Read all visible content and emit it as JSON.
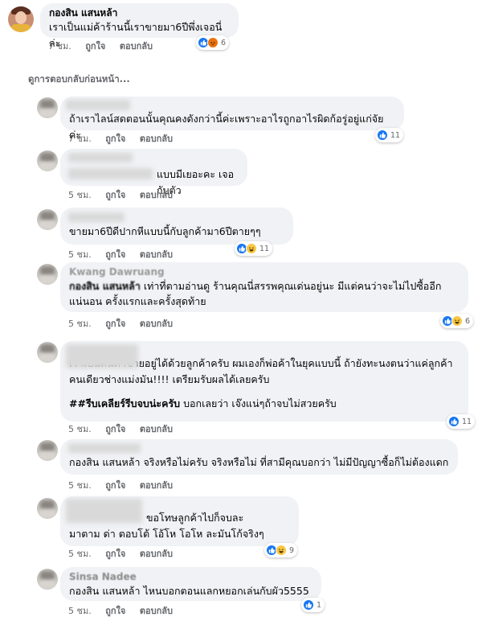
{
  "main_comment": {
    "author": "กองสิน แสนหล้า",
    "text": "เราเป็นแม่ค้าร้านนี้เราขายมา6ปีพึ่งเจอนี่ล่ะ",
    "time": "7 ชม.",
    "like_label": "ถูกใจ",
    "reply_label": "ตอบกลับ",
    "reaction_count": "6",
    "reaction_icons": [
      "like-icon",
      "angry-icon"
    ]
  },
  "previous_replies_label": "ดูการตอบกลับก่อนหน้า...",
  "replies": [
    {
      "text": "ถ้าเราไลน์สดตอนนั้นคุณคงดังกว่านี้ค่ะเพราะอาไรถูกอาไรผิดก้อรู่อยู่แก่จัยค่ะ",
      "time": "7 ชม.",
      "like_label": "ถูกใจ",
      "reply_label": "ตอบกลับ",
      "reaction_count": "11",
      "reaction_icons": [
        "like-icon"
      ]
    },
    {
      "text": "แบบมีเยอะคะ เจอกับตัว",
      "time": "5 ชม.",
      "like_label": "ถูกใจ",
      "reply_label": "ตอบกลับ"
    },
    {
      "text": "ขายมา6ปีดีปากหีแบบนี้กับลูกค้ามา6ปีตายๆๆ",
      "time": "5 ชม.",
      "like_label": "ถูกใจ",
      "reply_label": "ตอบกลับ",
      "reaction_count": "11",
      "reaction_icons": [
        "like-icon",
        "haha-icon"
      ]
    },
    {
      "author": "Kwang Dawruang",
      "tag": "กองสิน แสนหล้า",
      "text": " เท่าที่ตามอ่านดู ร้านคุณนี่สรรพคุณเด่นอยู่นะ มีแต่คนว่าจะไม่ไปซื้ออีกแน่นอน ครั้งแรกและครั้งสุดท้าย",
      "time": "5 ชม.",
      "like_label": "ถูกใจ",
      "reply_label": "ตอบกลับ",
      "reaction_count": "6",
      "reaction_icons": [
        "like-icon",
        "haha-icon"
      ]
    },
    {
      "line1": "เราเป็นคนค้าขายอยู่ได้ด้วยลูกค้าครับ   ผมเองก็พ่อค้าในยุคแบบนี้ ถ้ายังทะนงตนว่าแค่ลูกค้าคนเดียวช่างแม่งมัน!!!!      เตรียมรับผลได้เลยครับ",
      "tag2": "##รีบเคลียร์รีบจบน่ะครับ",
      "line2": " บอกเลยว่า เจ๊งแน่ๆถ้าจบไม่สวยครับ",
      "time": "5 ชม.",
      "like_label": "ถูกใจ",
      "reply_label": "ตอบกลับ",
      "reaction_count": "11",
      "reaction_icons": [
        "like-icon"
      ]
    },
    {
      "tag": "กองสิน แสนหล้า",
      "text": " จริงหรือไม่ครับ จริงหรือไม่ ที่สามีคุณบอกว่า ไม่มีปัญญาซื้อก็ไม่ต้องแดก",
      "time": "5 ชม.",
      "like_label": "ถูกใจ",
      "reply_label": "ตอบกลับ"
    },
    {
      "text": "ขอโทษลูกค้าไปก็จบละ มาตาม ด่า ตอบโต้ โอ้โห โอโห ละมันโก้จริงๆ",
      "line_a": "ขอโทษลูกค้าไปก็จบละ",
      "line_b": "มาตาม ด่า ตอบโต้ โอ้โห โอโห ละมันโก้จริงๆ",
      "time": "5 ชม.",
      "like_label": "ถูกใจ",
      "reply_label": "ตอบกลับ",
      "reaction_count": "9",
      "reaction_icons": [
        "like-icon",
        "haha-icon"
      ]
    },
    {
      "author": "Sinsa Nadee",
      "tag": "กองสิน แสนหล้า",
      "text": " ไหนบอกตอนแลกหยอกเล่นกับผัว5555",
      "time": "5 ชม.",
      "like_label": "ถูกใจ",
      "reply_label": "ตอบกลับ",
      "reaction_count": "1",
      "reaction_icons": [
        "like-icon"
      ]
    }
  ],
  "colors": {
    "bubble": "#f0f2f5",
    "meta": "#65676b",
    "like": "#1877f2",
    "haha": "#f7c844"
  }
}
